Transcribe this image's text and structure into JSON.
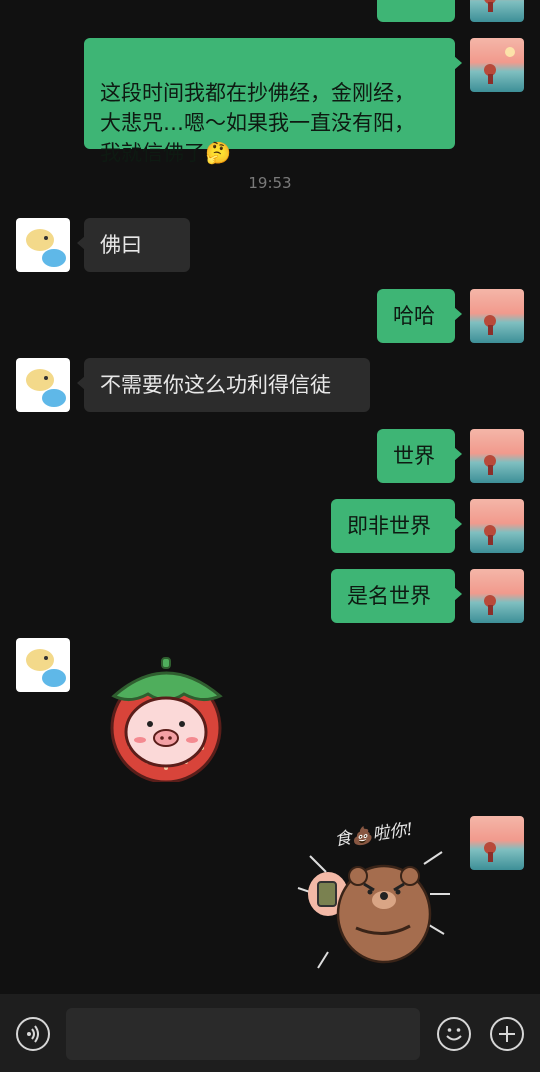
{
  "chat": {
    "messages": [
      {
        "text": "这段时间我都在抄佛经，金刚经，\n大悲咒…嗯～如果我一直没有阳，\n我就信佛了🤔"
      },
      {
        "text": "佛曰"
      },
      {
        "text": "哈哈"
      },
      {
        "text": "不需要你这么功利得信徒"
      },
      {
        "text": "世界"
      },
      {
        "text": "即非世界"
      },
      {
        "text": "是名世界"
      }
    ],
    "time_divider": "19:53",
    "sticker_text": "食💩啦你!"
  },
  "bottom_bar": {
    "voice_icon": "voice-icon",
    "emoji_icon": "emoji-icon",
    "plus_icon": "plus-icon"
  },
  "colors": {
    "background": "#111111",
    "outgoing_bubble": "#3eb575",
    "incoming_bubble": "#2c2c2c"
  }
}
